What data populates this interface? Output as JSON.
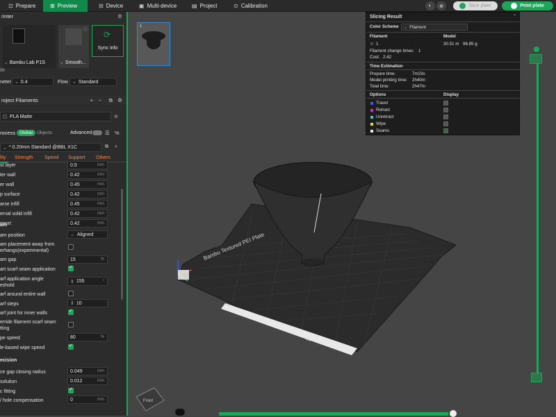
{
  "tabs": {
    "prepare": "Prepare",
    "preview": "Preview",
    "device": "Device",
    "multi_device": "Multi-device",
    "project": "Project",
    "calibration": "Calibration"
  },
  "top_actions": {
    "slice_plate": "Slice plate",
    "print_plate": "Print plate"
  },
  "printer": {
    "section": "rinter",
    "name": "Bambu Lab P1S",
    "plate": "Smooth...",
    "sync": "Sync info",
    "nozzle_label": "ile",
    "diameter_label": "neter",
    "diameter": "0.4",
    "flow_label": "Flow",
    "flow": "Standard"
  },
  "filaments": {
    "section": "roject Filaments",
    "item": "PLA Matte"
  },
  "process": {
    "label": "rocess",
    "global": "Global",
    "objects": "Objects",
    "advanced": "Advanced",
    "preset": "* 0.20mm Standard @BBL X1C",
    "tabs": [
      "lity",
      "Strength",
      "Speed",
      "Support",
      "Others"
    ]
  },
  "lines": [
    {
      "label": "st layer",
      "value": "0.5",
      "unit": "mm"
    },
    {
      "label": "ter wall",
      "value": "0.42",
      "unit": "mm"
    },
    {
      "label": "er wall",
      "value": "0.45",
      "unit": "mm"
    },
    {
      "label": "p surface",
      "value": "0.42",
      "unit": "mm"
    },
    {
      "label": "arse infill",
      "value": "0.45",
      "unit": "mm"
    },
    {
      "label": "ernal solid infill",
      "value": "0.42",
      "unit": "mm"
    },
    {
      "label": "pport",
      "value": "0.42",
      "unit": "mm"
    }
  ],
  "seam": {
    "section": "am",
    "position_label": "am position",
    "position": "Aligned",
    "placement_label1": "am placement away from",
    "placement_label2": "erhangs(experimental)",
    "gap_label": "am gap",
    "gap": "15",
    "gap_unit": "%",
    "scarf_label": "art scarf seam application",
    "angle_label1": "arf application angle",
    "angle_label2": "eshold",
    "angle": "155",
    "around_label": "arf around entire wall",
    "steps_label": "arf steps",
    "steps": "10",
    "inner_label": "arf joint for inner walls",
    "override_label1": "erride filament scarf seam",
    "override_label2": "tting",
    "wipe_label": "pe speed",
    "wipe": "80",
    "wipe_unit": "%",
    "role_label": "le-based wipe speed"
  },
  "precision": {
    "section": "ecision",
    "gap_label": "ce gap closing radius",
    "gap": "0.049",
    "res_label": "solution",
    "res": "0.012",
    "arc_label": "c fitting",
    "hole_label": "/ hole compensation",
    "hole": "0",
    "unit": "mm"
  },
  "slicing": {
    "title": "Slicing Result",
    "scheme_label": "Color Scheme",
    "scheme": "Filament",
    "col_filament": "Filament",
    "col_model": "Model",
    "fil_index": "1",
    "fil_len": "30.51 m",
    "fil_weight": "96.85 g",
    "changes_label": "Filament change times:",
    "changes": "1",
    "cost_label": "Cost:",
    "cost": "2.42",
    "time_title": "Time Estimation",
    "prep_label": "Prepare time:",
    "prep": "7m23s",
    "model_label": "Model printing time:",
    "model": "2h40m",
    "total_label": "Total time:",
    "total": "2h47m",
    "options": "Options",
    "display": "Display",
    "items": [
      {
        "name": "Travel",
        "color": "#3b5bff"
      },
      {
        "name": "Retract",
        "color": "#d02ad0"
      },
      {
        "name": "Unretract",
        "color": "#36c8c8"
      },
      {
        "name": "Wipe",
        "color": "#e8e020"
      },
      {
        "name": "Seams",
        "color": "#eeeeee"
      }
    ]
  },
  "plate": {
    "thumb_index": "1",
    "logo": "Bambu Textured PEI Plate",
    "corner": "01"
  }
}
